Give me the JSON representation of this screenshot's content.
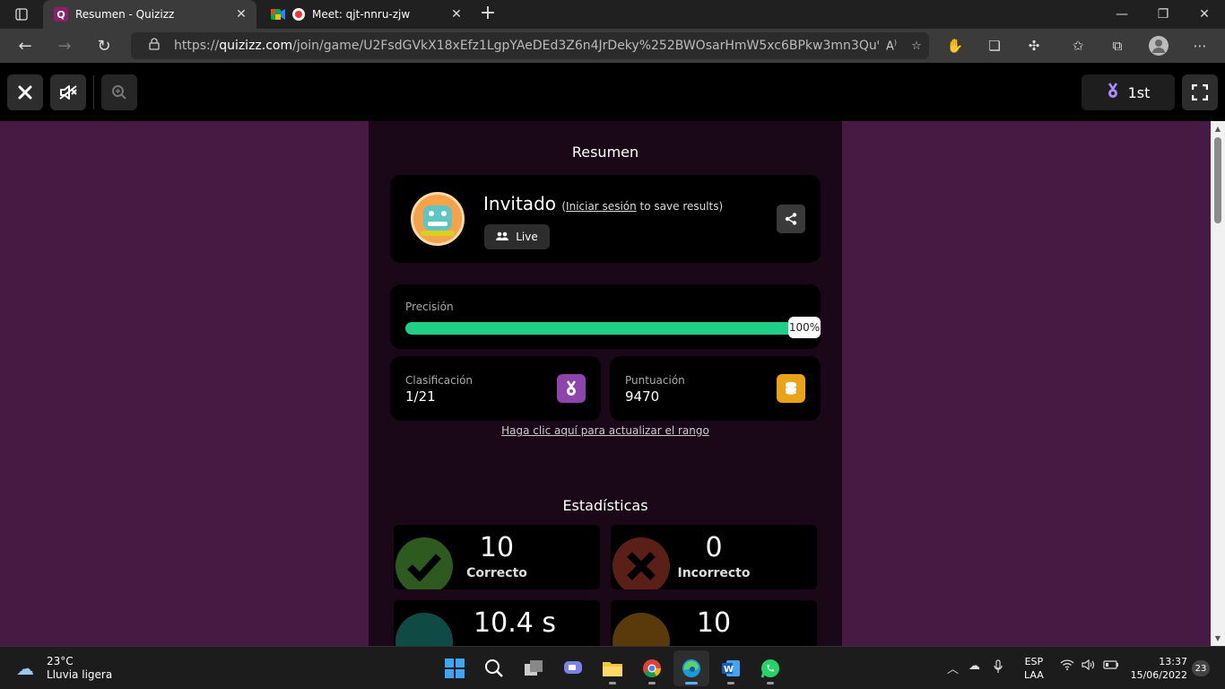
{
  "browser": {
    "tabs": [
      {
        "title": "Resumen - Quizizz",
        "favicon": "Q",
        "close": "✕"
      },
      {
        "title": "Meet: qjt-nnru-zjw",
        "close": "✕"
      }
    ],
    "new_tab": "+",
    "url_host": "quizizz.com",
    "url_prefix": "https://",
    "url_rest": "/join/game/U2FsdGVkX18xEfz1LgpYAeDEd3Z6n4JrDeky%252BWOsarHmW5xc6BPkw3mn3Qu%252BkW...",
    "window_controls": [
      "—",
      "❐",
      "✕"
    ]
  },
  "quiz_bar": {
    "rank_label": "1st"
  },
  "summary": {
    "title": "Resumen",
    "player_name": "Invitado",
    "login_prefix": "(",
    "login_link": "Iniciar sesión",
    "login_suffix": " to save results)",
    "mode_label": "Live",
    "accuracy_label": "Precisión",
    "accuracy_value": "100%",
    "accuracy_fraction": 1.0,
    "rank_title": "Clasificación",
    "rank_value": "1/21",
    "score_title": "Puntuación",
    "score_value": "9470",
    "refresh_link": "Haga clic aquí para actualizar el rango"
  },
  "stats": {
    "title": "Estadísticas",
    "items": [
      {
        "value": "10",
        "label": "Correcto",
        "color": "#2f5a1f"
      },
      {
        "value": "0",
        "label": "Incorrecto",
        "color": "#5a1f16"
      },
      {
        "value": "10.4 s",
        "label": "",
        "color": "#0f4a44"
      },
      {
        "value": "10",
        "label": "",
        "color": "#5a3a0a"
      }
    ]
  },
  "colors": {
    "page_bg": "#461a42",
    "panel_bg": "#1a0818",
    "accuracy_green": "#1fcf86",
    "rank_badge": "#8e44ad",
    "score_badge": "#e8a317"
  },
  "taskbar": {
    "temperature": "23°C",
    "weather": "Lluvia ligera",
    "lang_1": "ESP",
    "lang_2": "LAA",
    "time": "13:37",
    "date": "15/06/2022",
    "notifications": "23"
  }
}
